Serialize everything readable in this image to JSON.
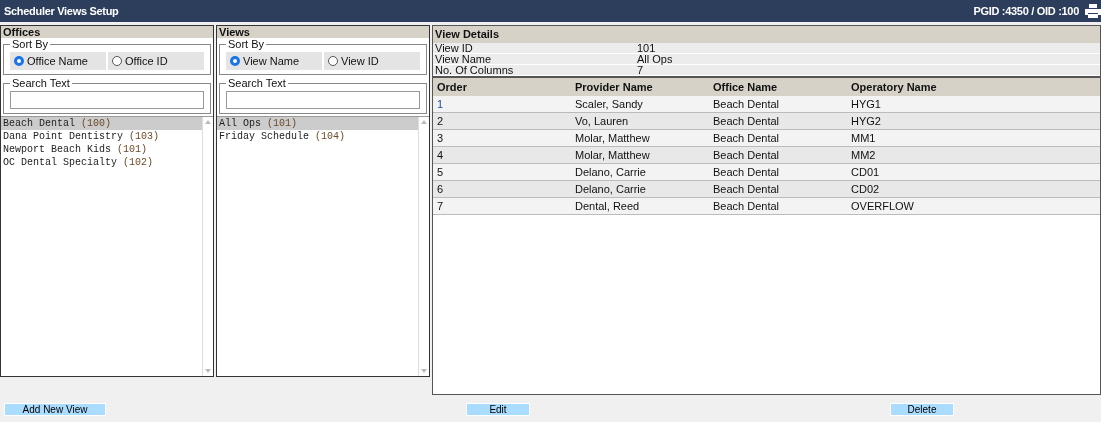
{
  "header": {
    "title": "Scheduler Views Setup",
    "ids": "PGID :4350  /  OID :100"
  },
  "offices": {
    "title": "Offices",
    "sort_by": {
      "legend": "Sort By",
      "options": [
        {
          "label": "Office Name",
          "selected": true
        },
        {
          "label": "Office ID",
          "selected": false
        }
      ]
    },
    "search": {
      "legend": "Search Text"
    },
    "items": [
      {
        "name": "Beach Dental",
        "id": "(100)",
        "selected": true
      },
      {
        "name": "Dana Point Dentistry",
        "id": "(103)",
        "selected": false
      },
      {
        "name": "Newport Beach Kids",
        "id": "(101)",
        "selected": false
      },
      {
        "name": "OC Dental Specialty",
        "id": "(102)",
        "selected": false
      }
    ]
  },
  "views": {
    "title": "Views",
    "sort_by": {
      "legend": "Sort By",
      "options": [
        {
          "label": "View Name",
          "selected": true
        },
        {
          "label": "View ID",
          "selected": false
        }
      ]
    },
    "search": {
      "legend": "Search Text"
    },
    "items": [
      {
        "name": "All Ops",
        "id": "(101)",
        "selected": true
      },
      {
        "name": "Friday Schedule",
        "id": "(104)",
        "selected": false
      }
    ]
  },
  "details": {
    "title": "View Details",
    "fields": [
      {
        "label": "View ID",
        "value": "101"
      },
      {
        "label": "View Name",
        "value": "All Ops"
      },
      {
        "label": "No. Of Columns",
        "value": "7"
      }
    ],
    "table": {
      "columns": [
        "Order",
        "Provider Name",
        "Office Name",
        "Operatory Name"
      ],
      "rows": [
        [
          "1",
          "Scaler, Sandy",
          "Beach Dental",
          "HYG1"
        ],
        [
          "2",
          "Vo, Lauren",
          "Beach Dental",
          "HYG2"
        ],
        [
          "3",
          "Molar, Matthew",
          "Beach Dental",
          "MM1"
        ],
        [
          "4",
          "Molar, Matthew",
          "Beach Dental",
          "MM2"
        ],
        [
          "5",
          "Delano, Carrie",
          "Beach Dental",
          "CD01"
        ],
        [
          "6",
          "Delano, Carrie",
          "Beach Dental",
          "CD02"
        ],
        [
          "7",
          "Dental, Reed",
          "Beach Dental",
          "OVERFLOW"
        ]
      ]
    }
  },
  "buttons": [
    "Add New View",
    "Edit",
    "Delete"
  ]
}
